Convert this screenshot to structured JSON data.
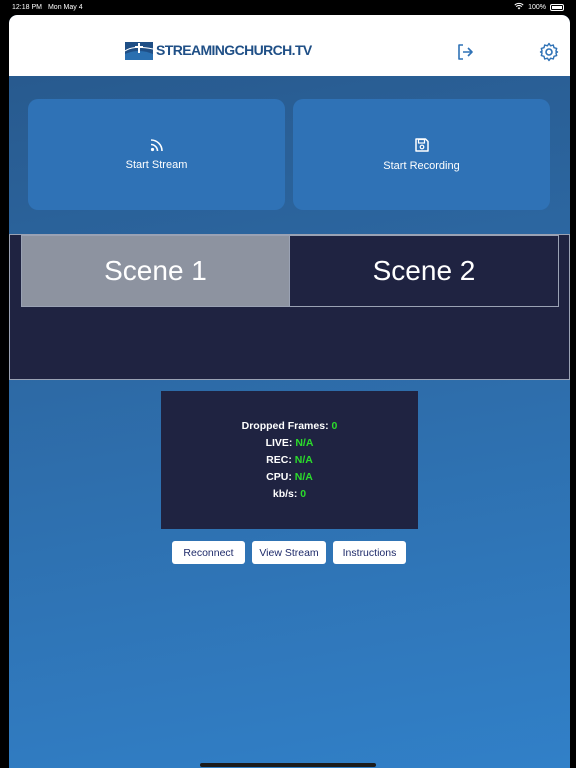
{
  "status_bar": {
    "time": "12:18 PM",
    "date": "Mon May 4",
    "battery": "100%",
    "icons": [
      "wifi-icon",
      "battery-icon"
    ]
  },
  "header": {
    "logo_text": "STREAMINGCHURCH.TV",
    "logout_icon": "sign-out-icon",
    "settings_icon": "gear-icon"
  },
  "actions": {
    "start_stream": {
      "label": "Start Stream",
      "icon": "broadcast-icon"
    },
    "start_recording": {
      "label": "Start Recording",
      "icon": "save-icon"
    }
  },
  "scenes": [
    {
      "label": "Scene 1",
      "selected": true
    },
    {
      "label": "Scene 2",
      "selected": false
    }
  ],
  "stats": {
    "dropped_frames": {
      "label": "Dropped Frames:",
      "value": "0"
    },
    "live": {
      "label": "LIVE:",
      "value": "N/A"
    },
    "rec": {
      "label": "REC:",
      "value": "N/A"
    },
    "cpu": {
      "label": "CPU:",
      "value": "N/A"
    },
    "kbs": {
      "label": "kb/s:",
      "value": "0"
    }
  },
  "buttons": {
    "reconnect": "Reconnect",
    "view_stream": "View Stream",
    "instructions": "Instructions"
  },
  "colors": {
    "accent": "#2f72b6",
    "dark_panel": "#1f2341",
    "stat_value": "#2bdc2b",
    "scene_selected": "#8d93a0",
    "brand": "#1f4f86"
  }
}
